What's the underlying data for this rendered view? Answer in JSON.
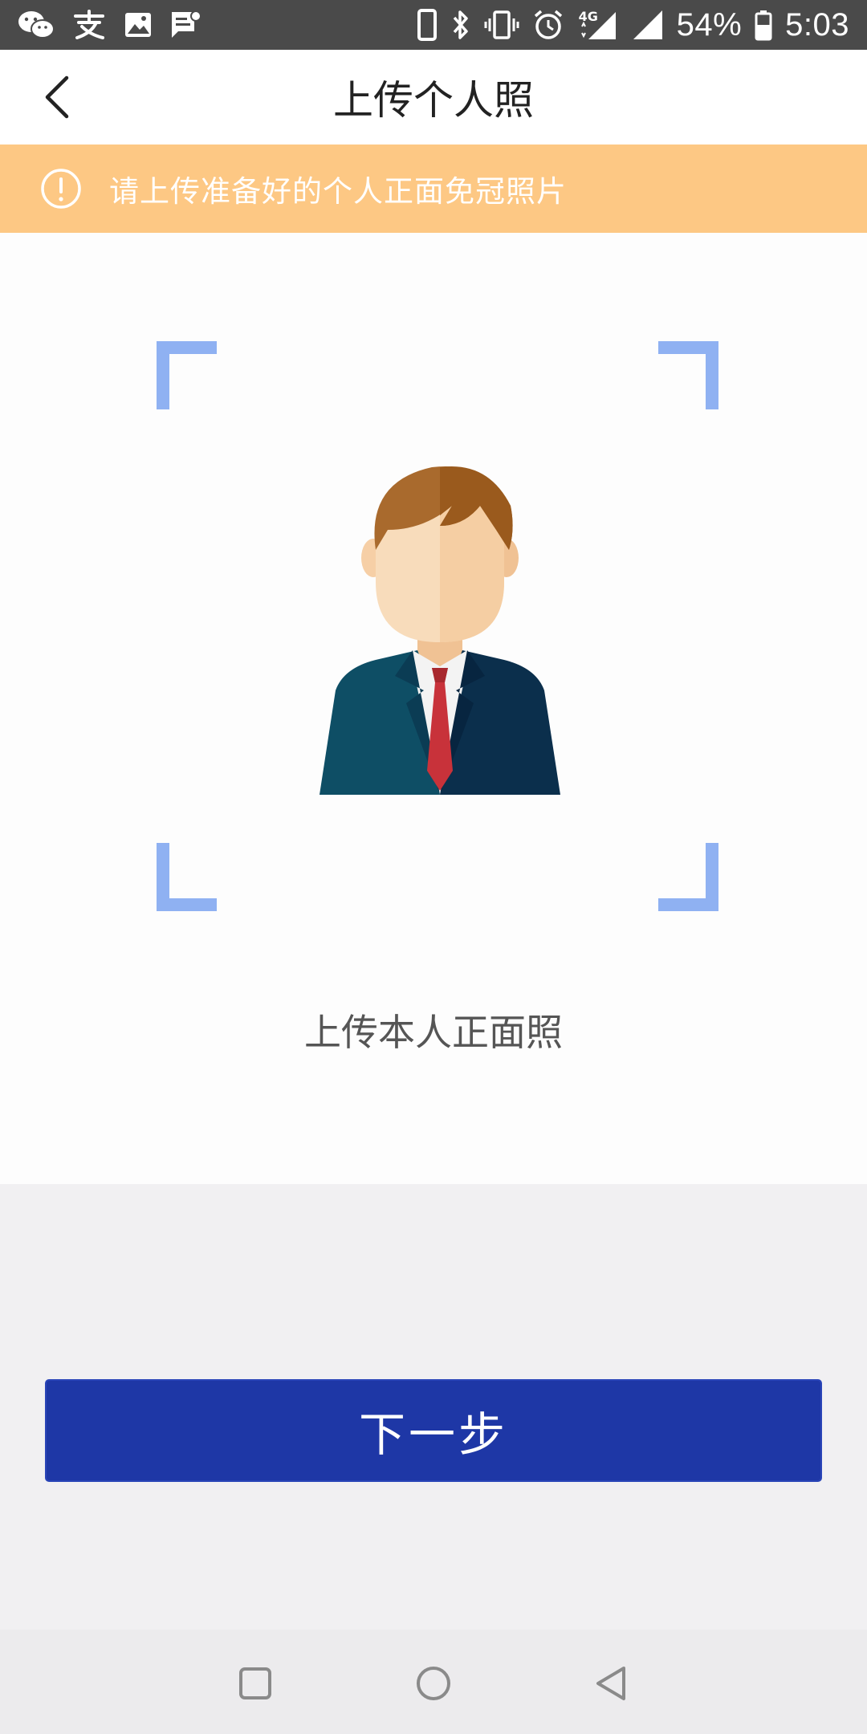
{
  "status_bar": {
    "battery_percent": "54%",
    "time": "5:03",
    "network": "4G",
    "icons": [
      "wechat-icon",
      "alipay-icon",
      "image-icon",
      "message-icon",
      "phone-icon",
      "bluetooth-icon",
      "vibrate-icon",
      "alarm-icon",
      "signal-icon",
      "signal-icon",
      "battery-icon"
    ]
  },
  "header": {
    "title": "上传个人照",
    "back_icon": "chevron-left-icon"
  },
  "notice": {
    "text": "请上传准备好的个人正面免冠照片",
    "icon": "warning-circle-icon"
  },
  "upload": {
    "caption": "上传本人正面照",
    "placeholder_icon": "person-avatar-icon"
  },
  "actions": {
    "next_label": "下一步"
  },
  "colors": {
    "notice_bg": "#fdc884",
    "button_bg": "#1e37a6",
    "frame_corner": "#8fb1f2"
  },
  "system_nav": {
    "icons": [
      "recents-icon",
      "home-icon",
      "back-icon"
    ]
  }
}
